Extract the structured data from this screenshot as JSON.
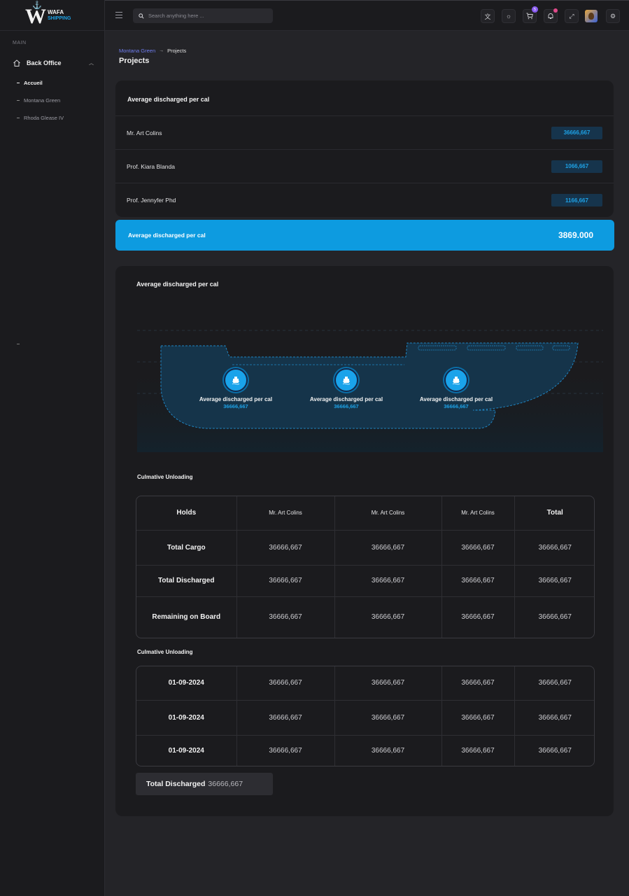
{
  "app": {
    "logo_line1": "WAFA",
    "logo_line2": "SHIPPING"
  },
  "sidebar": {
    "section_label": "MAIN",
    "main_item": "Back Office",
    "items": [
      {
        "label": "Accueil",
        "active": true
      },
      {
        "label": "Montana Green",
        "active": false
      },
      {
        "label": "Rhoda Glease IV",
        "active": false
      }
    ]
  },
  "topbar": {
    "search_placeholder": "Search anything here ...",
    "cart_badge": "5",
    "icons": [
      "translate-icon",
      "theme-icon",
      "cart-icon",
      "notification-icon",
      "fullscreen-icon",
      "settings-icon"
    ]
  },
  "breadcrumb": {
    "parent": "Montana Green",
    "current": "Projects"
  },
  "page_title": "Projects",
  "summary_card": {
    "title": "Average discharged per cal",
    "rows": [
      {
        "name": "Mr. Art Colins",
        "value": "36666,667"
      },
      {
        "name": "Prof. Kiara Blanda",
        "value": "1066,667"
      },
      {
        "name": "Prof. Jennyfer Phd",
        "value": "1166,667"
      }
    ]
  },
  "total_bar": {
    "label": "Average discharged per cal",
    "value": "3869.000"
  },
  "ship_card": {
    "title": "Average discharged per cal",
    "holds": [
      {
        "label": "Average discharged per cal",
        "value": "36666,667"
      },
      {
        "label": "Average discharged per cal",
        "value": "36666,667"
      },
      {
        "label": "Average discharged per cal",
        "value": "36666,667"
      }
    ]
  },
  "table1": {
    "title": "Culmative Unloading",
    "headers": [
      "Holds",
      "Mr. Art Colins",
      "Mr. Art Colins",
      "Mr. Art Colins",
      "Total"
    ],
    "rows": [
      {
        "label": "Total Cargo",
        "values": [
          "36666,667",
          "36666,667",
          "36666,667",
          "36666,667"
        ]
      },
      {
        "label": "Total Discharged",
        "values": [
          "36666,667",
          "36666,667",
          "36666,667",
          "36666,667"
        ]
      },
      {
        "label": "Remaining on Board",
        "values": [
          "36666,667",
          "36666,667",
          "36666,667",
          "36666,667"
        ]
      }
    ]
  },
  "table2": {
    "title": "Culmative Unloading",
    "rows": [
      {
        "label": "01-09-2024",
        "values": [
          "36666,667",
          "36666,667",
          "36666,667",
          "36666,667"
        ]
      },
      {
        "label": "01-09-2024",
        "values": [
          "36666,667",
          "36666,667",
          "36666,667",
          "36666,667"
        ]
      },
      {
        "label": "01-09-2024",
        "values": [
          "36666,667",
          "36666,667",
          "36666,667",
          "36666,667"
        ]
      }
    ]
  },
  "total_discharged": {
    "label": "Total Discharged",
    "value": "36666,667"
  },
  "colors": {
    "accent": "#0d9be0",
    "accent_text": "#1ea2e6",
    "pill_bg": "#16344c",
    "link": "#6f7ef0",
    "card_bg": "#1b1b1e",
    "page_bg": "#242428"
  }
}
